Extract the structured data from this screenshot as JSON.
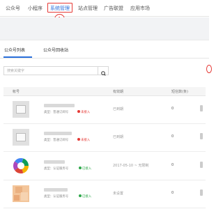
{
  "nav": {
    "items": [
      {
        "label": "公众号",
        "active": false
      },
      {
        "label": "小程序",
        "active": false
      },
      {
        "label": "系统管理",
        "active": true
      },
      {
        "label": "站点管理",
        "active": false
      },
      {
        "label": "广告联盟",
        "active": false
      },
      {
        "label": "应用市场",
        "active": false
      }
    ],
    "annotation_number": "1"
  },
  "tabs": [
    {
      "label": "公众号列表",
      "active": true
    },
    {
      "label": "公众号回收站",
      "active": false
    }
  ],
  "search": {
    "placeholder": "搜索关键字"
  },
  "table": {
    "headers": {
      "account": "帐号",
      "validity": "有效期",
      "sms": "短信数(条)"
    },
    "rows": [
      {
        "type": "类型：普通订阅号",
        "status": "未接入",
        "status_color": "red",
        "validity": "已到期",
        "count": "0",
        "icon": "image-placeholder-icon"
      },
      {
        "type": "类型：普通订阅号",
        "status": "未接入",
        "status_color": "red",
        "validity": "已到期",
        "count": "0",
        "icon": "image-placeholder-icon"
      },
      {
        "type": "类型：认证服务号",
        "status": "已接入",
        "status_color": "green",
        "validity": "2017-05-10 ~ 无限制",
        "count": "0",
        "icon": "color-ring-avatar"
      },
      {
        "type": "类型：认证服务号",
        "status": "已接入",
        "status_color": "green",
        "validity": "未设置",
        "count": "0",
        "icon": "blurred-avatar"
      }
    ]
  },
  "colors": {
    "accent": "#2a6fdb",
    "annotation": "#e53935",
    "connected": "#2ea84a"
  }
}
